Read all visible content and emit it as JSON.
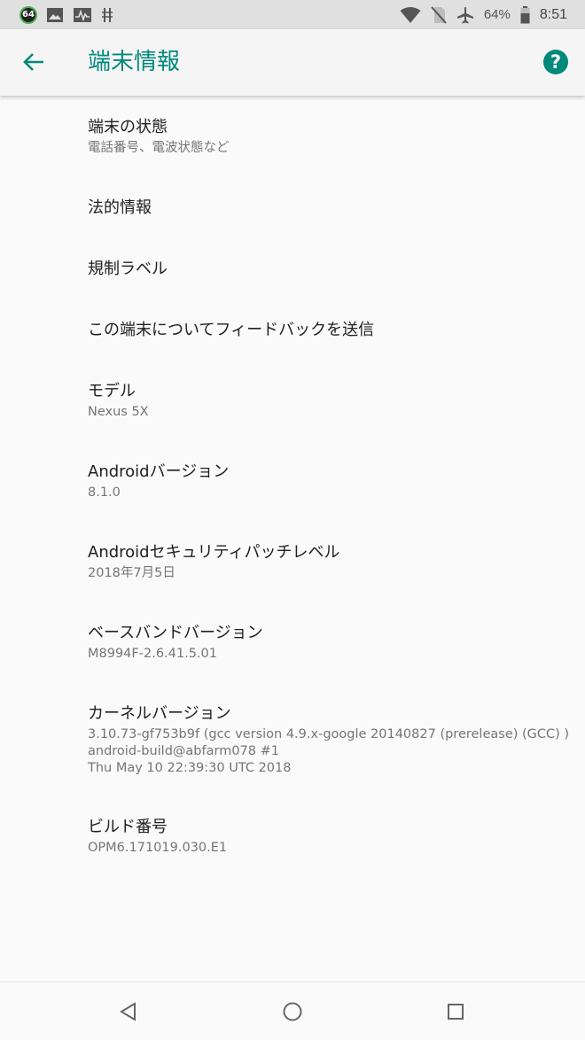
{
  "status_bar": {
    "badge": "64",
    "battery_percent": "64%",
    "time": "8:51",
    "icons": [
      "gallery-icon",
      "activity-icon",
      "usb-debug-icon",
      "wifi-icon",
      "no-sim-icon",
      "airplane-icon",
      "battery-icon"
    ]
  },
  "app_bar": {
    "title": "端末情報",
    "accent_color": "#00897b",
    "icons": [
      "back-arrow-icon",
      "help-icon"
    ]
  },
  "items": [
    {
      "title": "端末の状態",
      "summary": "電話番号、電波状態など"
    },
    {
      "title": "法的情報"
    },
    {
      "title": "規制ラベル"
    },
    {
      "title": "この端末についてフィードバックを送信"
    },
    {
      "title": "モデル",
      "summary": "Nexus 5X"
    },
    {
      "title": "Androidバージョン",
      "summary": "8.1.0"
    },
    {
      "title": "Androidセキュリティパッチレベル",
      "summary": "2018年7月5日"
    },
    {
      "title": "ベースバンドバージョン",
      "summary": "M8994F-2.6.41.5.01"
    },
    {
      "title": "カーネルバージョン",
      "summary_lines": [
        "3.10.73-gf753b9f (gcc version 4.9.x-google 20140827 (prerelease) (GCC) )",
        "android-build@abfarm078 #1",
        "Thu May 10 22:39:30 UTC 2018"
      ]
    },
    {
      "title": "ビルド番号",
      "summary": "OPM6.171019.030.E1"
    }
  ],
  "nav_bar": {
    "icons": [
      "back-triangle-icon",
      "home-circle-icon",
      "recents-square-icon"
    ]
  }
}
